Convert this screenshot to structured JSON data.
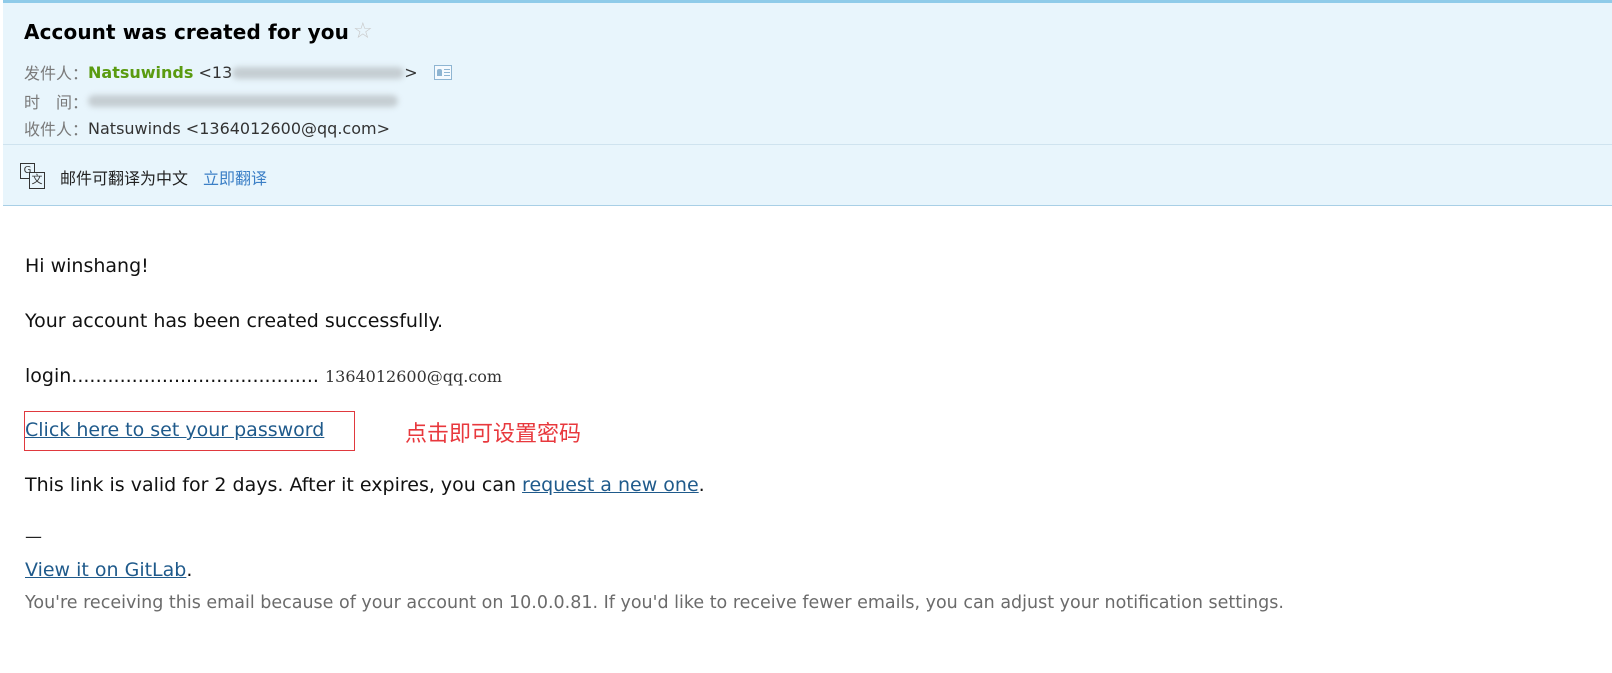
{
  "header": {
    "subject": "Account was created for you",
    "from_label": "发件人：",
    "sender_name": "Natsuwinds",
    "sender_addr_start": "<13",
    "sender_addr_end": ">",
    "time_label": "时　间：",
    "to_label": "收件人：",
    "recipient_name": "Natsuwinds",
    "recipient_addr": "<1364012600@qq.com>",
    "translate_text": "邮件可翻译为中文",
    "translate_link": "立即翻译",
    "icons": {
      "star": "star-icon",
      "contact": "contact-card-icon",
      "translate": "translate-icon"
    }
  },
  "body": {
    "greeting": "Hi winshang!",
    "created": "Your account has been created successfully.",
    "login_label": "login.........................................",
    "login_value": "1364012600@qq.com",
    "set_password_link": "Click here to set your password",
    "annotation": "点击即可设置密码",
    "valid_prefix": "This link is valid for 2 days. After it expires, you can ",
    "request_link": "request a new one",
    "valid_suffix": ".",
    "dash": "—",
    "gitlab_link": "View it on GitLab",
    "gitlab_suffix": ".",
    "footer": "You're receiving this email because of your account on 10.0.0.81. If you'd like to receive fewer emails, you can adjust your notification settings."
  },
  "colors": {
    "header_bg": "#e8f5fc",
    "sender_green": "#5a9b11",
    "link_blue": "#1f5a8b",
    "translate_link": "#3b7fc6",
    "annotation_red": "#e8383d"
  }
}
